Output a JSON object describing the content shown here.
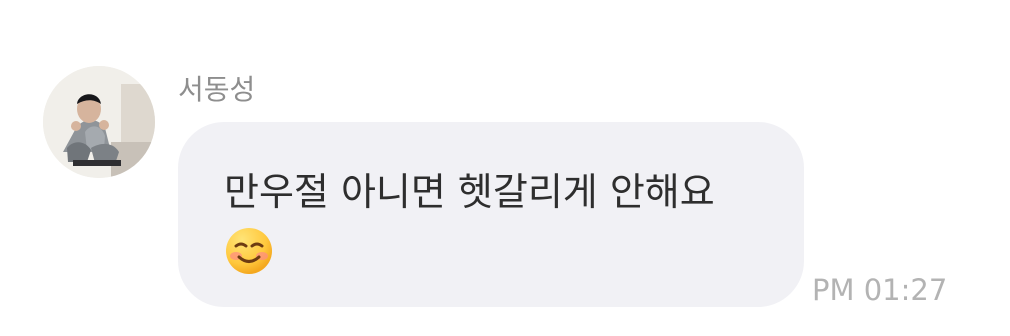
{
  "message": {
    "sender_name": "서동성",
    "text": "만우절 아니면 헷갈리게 안해요",
    "emoji": "smiling-face-with-rosy-cheeks",
    "time": "PM 01:27"
  },
  "colors": {
    "background": "#ffffff",
    "bubble": "#f1f1f5",
    "sender_name": "#8e8e8e",
    "message_text": "#2e2e2e",
    "timestamp": "#b3b3b3",
    "emoji_face": "#ffc83d"
  }
}
